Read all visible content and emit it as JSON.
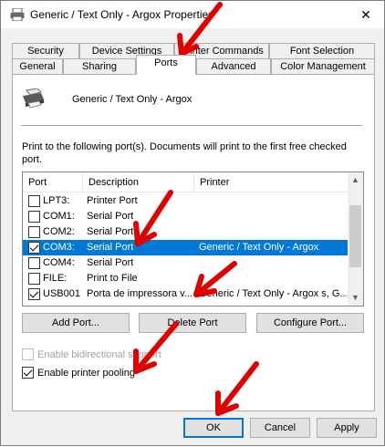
{
  "window": {
    "title": "Generic / Text Only - Argox Properties",
    "close_glyph": "✕"
  },
  "tabs_row1": [
    "Security",
    "Device Settings",
    "Printer Commands",
    "Font Selection"
  ],
  "tabs_row2": [
    "General",
    "Sharing",
    "Ports",
    "Advanced",
    "Color Management"
  ],
  "active_tab": "Ports",
  "printer": {
    "name": "Generic / Text Only - Argox",
    "icon": "printer-icon"
  },
  "instructions": "Print to the following port(s). Documents will print to the first free checked port.",
  "list": {
    "columns": [
      "Port",
      "Description",
      "Printer"
    ],
    "rows": [
      {
        "checked": false,
        "port": "LPT3:",
        "description": "Printer Port",
        "printer": "",
        "selected": false
      },
      {
        "checked": false,
        "port": "COM1:",
        "description": "Serial Port",
        "printer": "",
        "selected": false
      },
      {
        "checked": false,
        "port": "COM2:",
        "description": "Serial Port",
        "printer": "",
        "selected": false
      },
      {
        "checked": true,
        "port": "COM3:",
        "description": "Serial Port",
        "printer": "Generic / Text Only - Argox",
        "selected": true
      },
      {
        "checked": false,
        "port": "COM4:",
        "description": "Serial Port",
        "printer": "",
        "selected": false
      },
      {
        "checked": false,
        "port": "FILE:",
        "description": "Print to File",
        "printer": "",
        "selected": false
      },
      {
        "checked": true,
        "port": "USB001",
        "description": "Porta de impressora v...",
        "printer": "Generic / Text Only - Argox s, G...",
        "selected": false
      }
    ]
  },
  "buttons": {
    "add_port": "Add Port...",
    "delete_port": "Delete Port",
    "configure_port": "Configure Port...",
    "ok": "OK",
    "cancel": "Cancel",
    "apply": "Apply"
  },
  "options": {
    "bidirectional": {
      "label": "Enable bidirectional support",
      "checked": false,
      "enabled": false
    },
    "pooling": {
      "label": "Enable printer pooling",
      "checked": true,
      "enabled": true
    }
  },
  "colors": {
    "selection": "#0078d7",
    "arrow": "#e00000",
    "accent": "#0078d7"
  }
}
